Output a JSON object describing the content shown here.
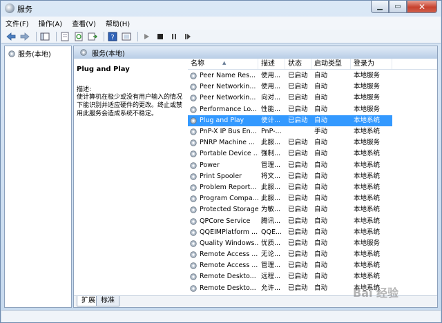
{
  "window": {
    "title": "服务"
  },
  "menu": [
    "文件(F)",
    "操作(A)",
    "查看(V)",
    "帮助(H)"
  ],
  "tree": {
    "item": "服务(本地)"
  },
  "right_header": "服务(本地)",
  "details": {
    "title": "Plug and Play",
    "label": "描述:",
    "text": "使计算机在极少或没有用户输入的情况下能识别并适应硬件的更改。终止或禁用此服务会造成系统不稳定。"
  },
  "columns": [
    "名称",
    "描述",
    "状态",
    "启动类型",
    "登录为"
  ],
  "services": [
    {
      "name": "Peer Name Res...",
      "desc": "使用...",
      "status": "已启动",
      "start": "自动",
      "logon": "本地服务"
    },
    {
      "name": "Peer Networkin...",
      "desc": "使用...",
      "status": "已启动",
      "start": "自动",
      "logon": "本地服务"
    },
    {
      "name": "Peer Networkin...",
      "desc": "向对...",
      "status": "已启动",
      "start": "自动",
      "logon": "本地服务"
    },
    {
      "name": "Performance Lo...",
      "desc": "性能...",
      "status": "已启动",
      "start": "自动",
      "logon": "本地服务"
    },
    {
      "name": "Plug and Play",
      "desc": "使计...",
      "status": "已启动",
      "start": "自动",
      "logon": "本地系统",
      "selected": true
    },
    {
      "name": "PnP-X IP Bus En...",
      "desc": "PnP-...",
      "status": "",
      "start": "手动",
      "logon": "本地系统"
    },
    {
      "name": "PNRP Machine ...",
      "desc": "此服...",
      "status": "已启动",
      "start": "自动",
      "logon": "本地服务"
    },
    {
      "name": "Portable Device ...",
      "desc": "强制...",
      "status": "已启动",
      "start": "自动",
      "logon": "本地系统"
    },
    {
      "name": "Power",
      "desc": "管理...",
      "status": "已启动",
      "start": "自动",
      "logon": "本地系统"
    },
    {
      "name": "Print Spooler",
      "desc": "将文...",
      "status": "已启动",
      "start": "自动",
      "logon": "本地系统"
    },
    {
      "name": "Problem Report...",
      "desc": "此服...",
      "status": "已启动",
      "start": "自动",
      "logon": "本地系统"
    },
    {
      "name": "Program Compa...",
      "desc": "此服...",
      "status": "已启动",
      "start": "自动",
      "logon": "本地系统"
    },
    {
      "name": "Protected Storage",
      "desc": "为敏...",
      "status": "已启动",
      "start": "自动",
      "logon": "本地系统"
    },
    {
      "name": "QPCore Service",
      "desc": "腾讯...",
      "status": "已启动",
      "start": "自动",
      "logon": "本地系统"
    },
    {
      "name": "QQEIMPlatform ...",
      "desc": "QQE...",
      "status": "已启动",
      "start": "自动",
      "logon": "本地系统"
    },
    {
      "name": "Quality Windows...",
      "desc": "优质...",
      "status": "已启动",
      "start": "自动",
      "logon": "本地服务"
    },
    {
      "name": "Remote Access ...",
      "desc": "无论...",
      "status": "已启动",
      "start": "自动",
      "logon": "本地系统"
    },
    {
      "name": "Remote Access ...",
      "desc": "管理...",
      "status": "已启动",
      "start": "自动",
      "logon": "本地系统"
    },
    {
      "name": "Remote Deskto...",
      "desc": "远程...",
      "status": "已启动",
      "start": "自动",
      "logon": "本地系统"
    },
    {
      "name": "Remote Deskto...",
      "desc": "允许...",
      "status": "已启动",
      "start": "自动",
      "logon": "本地系统"
    }
  ],
  "tabs": [
    "扩展",
    "标准"
  ],
  "watermark": "Bai 经验"
}
